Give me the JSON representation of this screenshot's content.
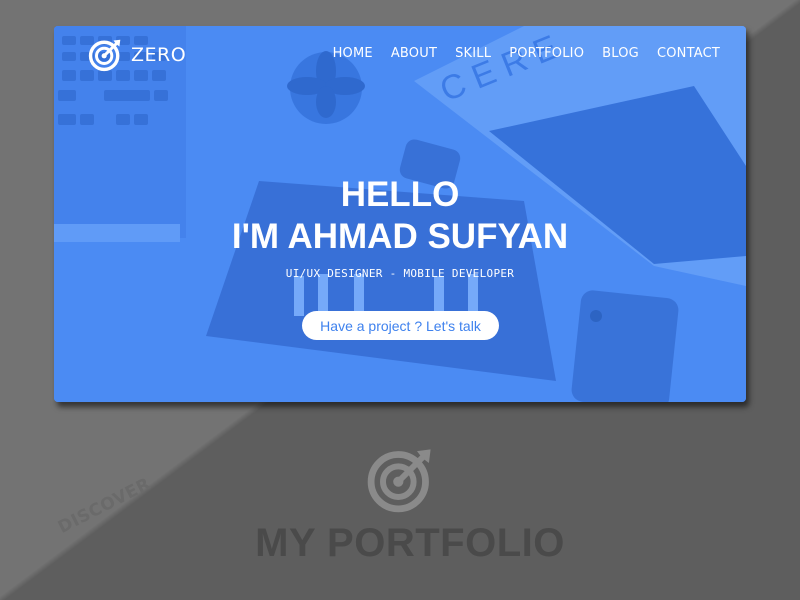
{
  "brand": {
    "name": "ZERO",
    "icon": "target-dart-icon"
  },
  "nav": {
    "items": [
      {
        "label": "HOME"
      },
      {
        "label": "ABOUT"
      },
      {
        "label": "SKILL"
      },
      {
        "label": "PORTFOLIO"
      },
      {
        "label": "BLOG"
      },
      {
        "label": "CONTACT"
      }
    ]
  },
  "hero": {
    "greeting": "HELLO",
    "name": "I'M AHMAD SUFYAN",
    "subtitle": "UI/UX DESIGNER - MOBILE DEVELOPER",
    "cta_label": "Have a project ? Let's talk",
    "background": "desk-workspace-photo",
    "overlay_color": "#4d8df6"
  },
  "section": {
    "discover_label": "DISCOVER",
    "title": "MY PORTFOLIO",
    "icon": "target-dart-icon"
  },
  "colors": {
    "page_background": "#6b6b6b",
    "accent": "#4f8ef3",
    "button_text": "#3f82ee",
    "section_title": "#4a4a4a"
  }
}
